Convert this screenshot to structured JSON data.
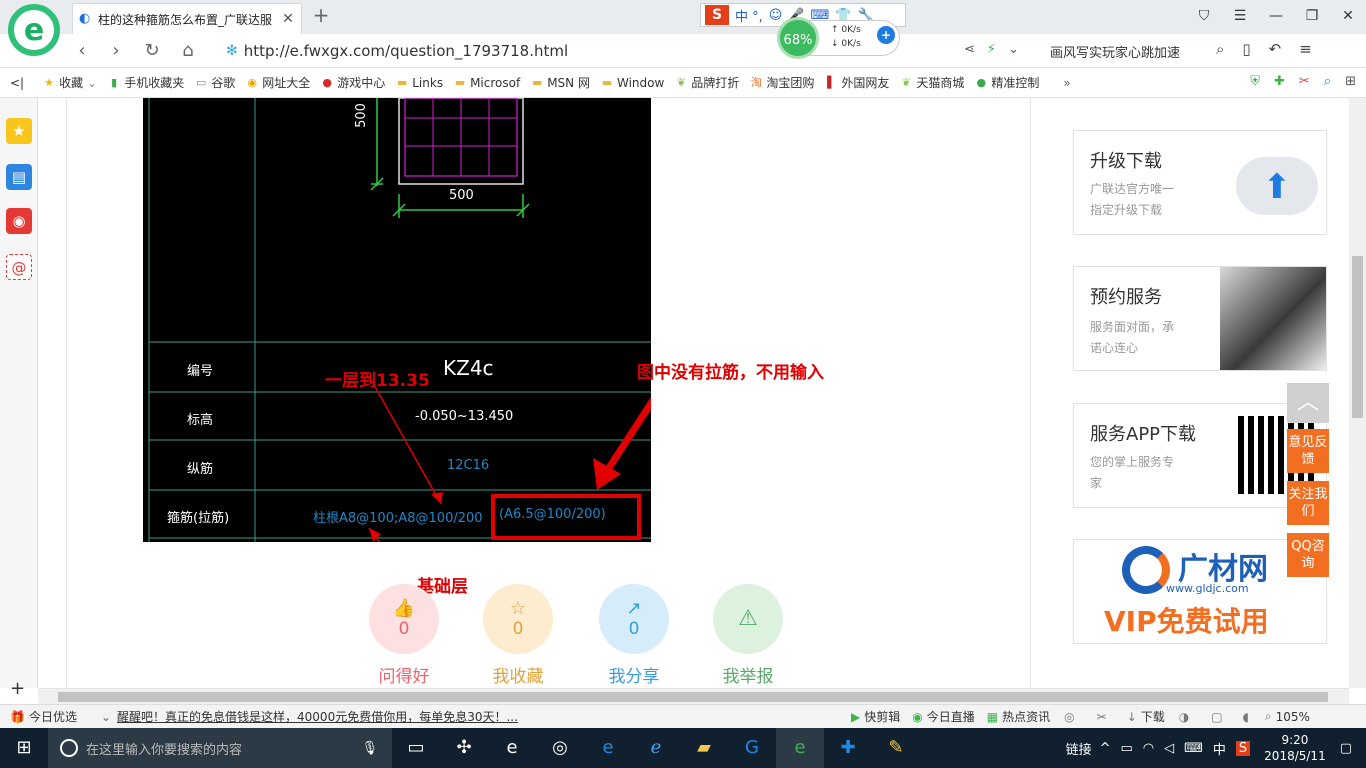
{
  "browser": {
    "tab_title": "柱的这种箍筋怎么布置_广联达服",
    "url": "http://e.fwxgx.com/question_1793718.html",
    "hot_search": "画风写实玩家心跳加速",
    "ime_label": "中 °,",
    "net_percent": "68%",
    "net_up": "0K/s",
    "net_down": "0K/s"
  },
  "bookmarks": [
    {
      "label": "收藏",
      "icon": "star-icon"
    },
    {
      "label": "手机收藏夹",
      "icon": "phone-icon"
    },
    {
      "label": "谷歌",
      "icon": "page-icon"
    },
    {
      "label": "网址大全",
      "icon": "globe-icon"
    },
    {
      "label": "游戏中心",
      "icon": "game-icon"
    },
    {
      "label": "Links",
      "icon": "folder-icon"
    },
    {
      "label": "Microsof",
      "icon": "folder-icon"
    },
    {
      "label": "MSN 网",
      "icon": "folder-icon"
    },
    {
      "label": "Window",
      "icon": "folder-icon"
    },
    {
      "label": "品牌打折",
      "icon": "leaf-icon"
    },
    {
      "label": "淘宝团购",
      "icon": "taobao-icon"
    },
    {
      "label": "外国网友",
      "icon": "flag-icon"
    },
    {
      "label": "天猫商城",
      "icon": "leaf-icon"
    },
    {
      "label": "精准控制",
      "icon": "chat-icon"
    }
  ],
  "cad": {
    "dim_side": "500",
    "dim_bottom": "500",
    "rows": [
      {
        "label": "编号",
        "value": "KZ4c"
      },
      {
        "label": "标高",
        "value": "-0.050~13.450"
      },
      {
        "label": "纵筋",
        "value": "12C16"
      },
      {
        "label": "箍筋(拉筋)",
        "value": "柱根A8@100;A8@100/200",
        "extra": "(A6.5@100/200)"
      }
    ]
  },
  "annotations": {
    "floor": "一层到13.35",
    "no_tie": "图中没有拉筋，不用输入",
    "foundation": "基础层"
  },
  "actions": [
    {
      "count": "0",
      "label": "问得好",
      "color": "#e8646f",
      "bg": "#fde0e2",
      "icon": "👍"
    },
    {
      "count": "0",
      "label": "我收藏",
      "color": "#e0a23c",
      "bg": "#fdeccf",
      "icon": "☆"
    },
    {
      "count": "0",
      "label": "我分享",
      "color": "#3a9ed8",
      "bg": "#d5ecfa",
      "icon": "↗"
    },
    {
      "count": "",
      "label": "我举报",
      "color": "#5aa96b",
      "bg": "#dcf2df",
      "icon": "⚠"
    }
  ],
  "right_cards": [
    {
      "title": "升级下载",
      "desc1": "广联达官方唯一",
      "desc2": "指定升级下载"
    },
    {
      "title": "预约服务",
      "desc1": "服务面对面，承",
      "desc2": "诺心连心"
    },
    {
      "title": "服务APP下载",
      "desc1": "您的掌上服务专",
      "desc2": "家"
    }
  ],
  "ad": {
    "brand": "广材网",
    "site": "www.gldjc.com",
    "promo": "VIP免费试用"
  },
  "float_buttons": [
    "意见反馈",
    "关注我们",
    "QQ咨询"
  ],
  "status": {
    "today": "今日优选",
    "news": "醒醒吧！真正的免息借钱是这样，40000元免费借你用，每单免息30天！...",
    "items": [
      "快剪辑",
      "今日直播",
      "热点资讯",
      "下载"
    ],
    "zoom": "105%"
  },
  "taskbar": {
    "search_placeholder": "在这里输入你要搜索的内容",
    "links": "链接",
    "ime": "中",
    "time": "9:20",
    "date": "2018/5/11"
  }
}
